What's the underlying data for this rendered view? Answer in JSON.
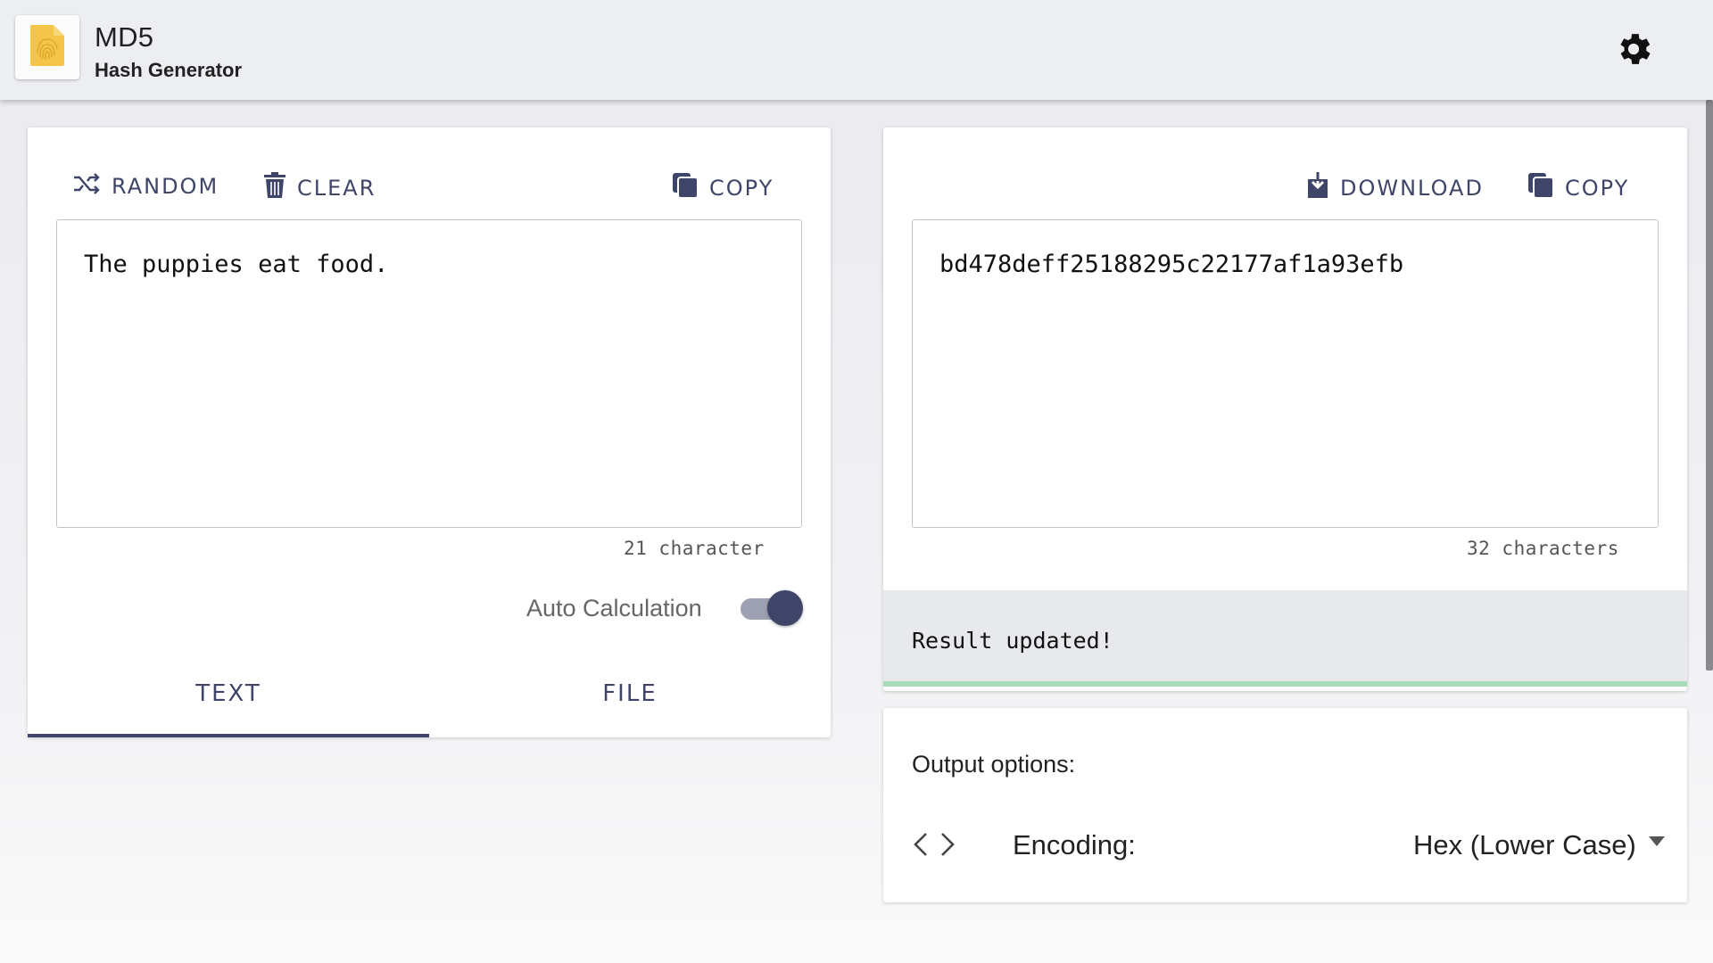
{
  "header": {
    "title": "MD5",
    "subtitle": "Hash Generator",
    "logo_icon": "document-fingerprint-icon",
    "settings_icon": "gear-icon"
  },
  "input_panel": {
    "random_label": "RANDOM",
    "clear_label": "CLEAR",
    "copy_label": "COPY",
    "text_value": "The puppies eat food.",
    "char_count": "21 character",
    "auto_calc_label": "Auto Calculation",
    "auto_calc_enabled": true,
    "tabs": [
      {
        "label": "TEXT",
        "active": true
      },
      {
        "label": "FILE",
        "active": false
      }
    ]
  },
  "output_panel": {
    "download_label": "DOWNLOAD",
    "copy_label": "COPY",
    "hash_value": "bd478deff25188295c22177af1a93efb",
    "char_count": "32 characters",
    "status": "Result updated!"
  },
  "options": {
    "title": "Output options:",
    "encoding_label": "Encoding:",
    "encoding_value": "Hex (Lower Case)",
    "encoding_icon": "code-brackets-icon"
  },
  "colors": {
    "accent": "#3f4569",
    "logo": "#f3c64a",
    "status_bar": "#a8dcb8"
  }
}
